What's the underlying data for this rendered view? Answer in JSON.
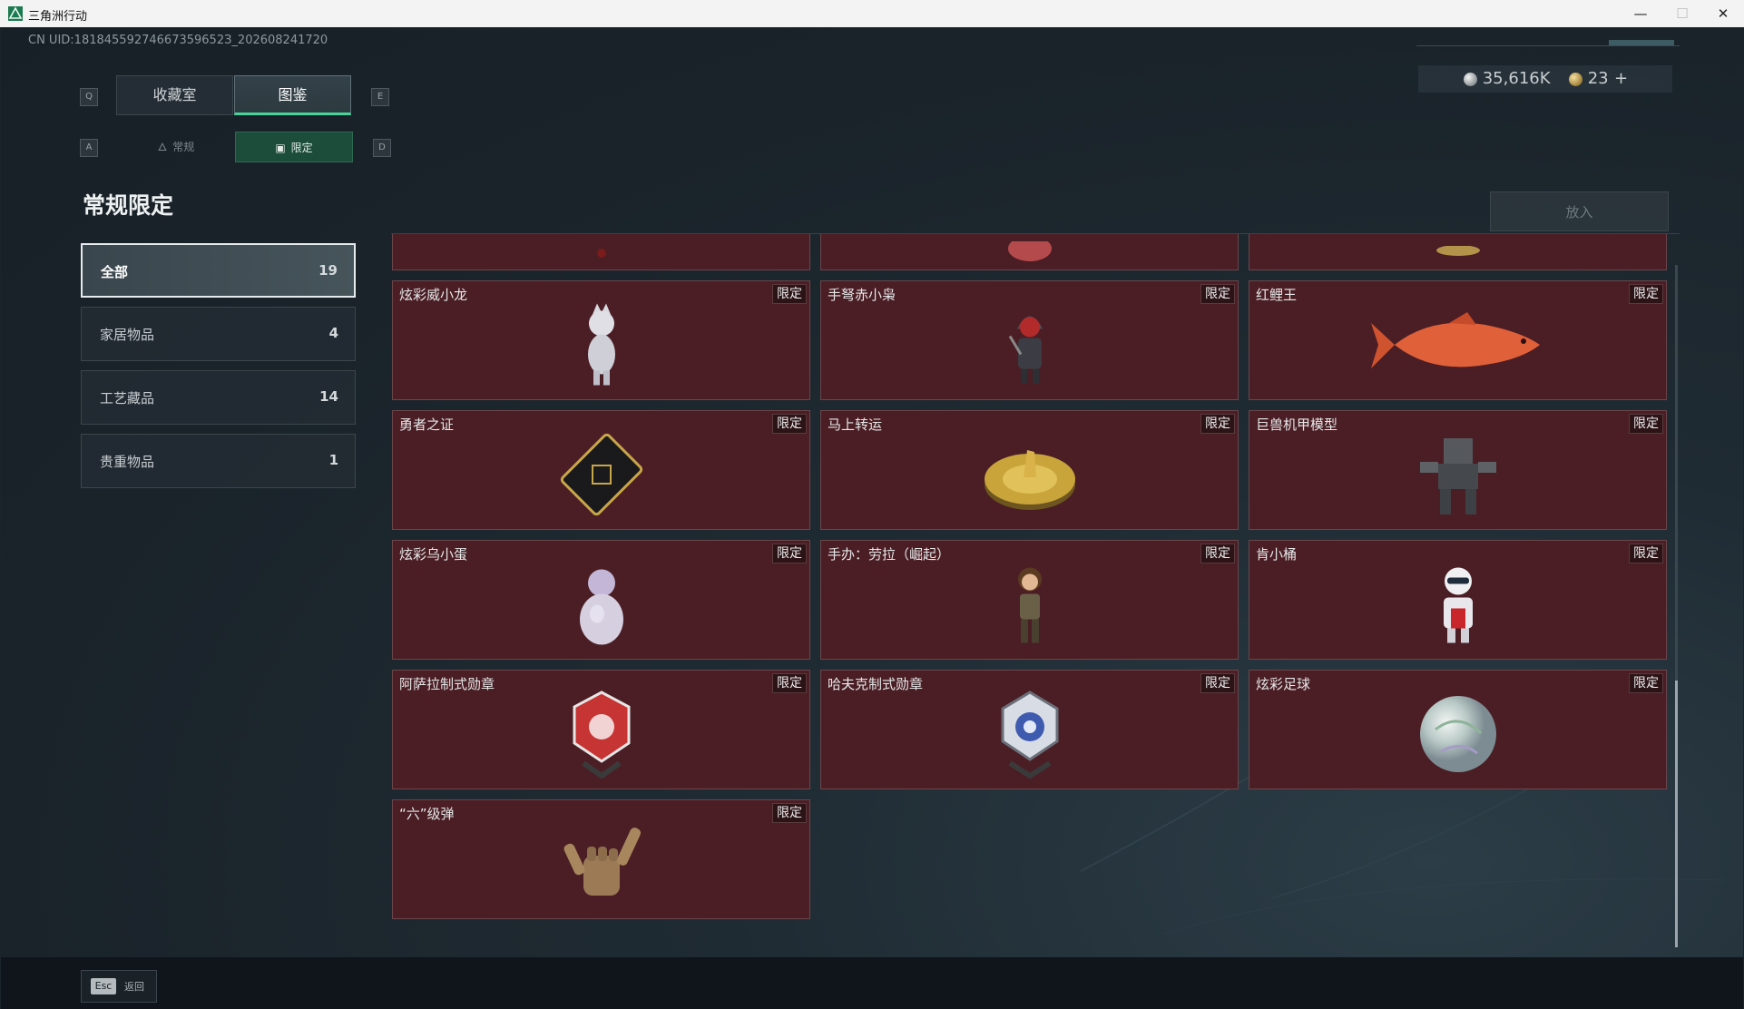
{
  "window": {
    "title": "三角洲行动",
    "minimize": "—",
    "maximize": "☐",
    "close": "✕"
  },
  "uid": "CN UID:18184559274667359652З_202608241720",
  "currency": {
    "silver": "35,616K",
    "gold": "23",
    "add": "+"
  },
  "tabs": {
    "prev_key": "Q",
    "next_key": "E",
    "items": [
      {
        "label": "收藏室"
      },
      {
        "label": "图鉴"
      }
    ]
  },
  "subtabs": {
    "prev_key": "A",
    "next_key": "D",
    "items": [
      {
        "label": "常规"
      },
      {
        "label": "限定"
      }
    ]
  },
  "section_title": "常规限定",
  "put_button": "放入",
  "categories": [
    {
      "label": "全部",
      "count": "19"
    },
    {
      "label": "家居物品",
      "count": "4"
    },
    {
      "label": "工艺藏品",
      "count": "14"
    },
    {
      "label": "贵重物品",
      "count": "1"
    }
  ],
  "cards": [
    {
      "name": "炫彩威小龙",
      "tag": "限定"
    },
    {
      "name": "手弩赤小枭",
      "tag": "限定"
    },
    {
      "name": "红鲤王",
      "tag": "限定"
    },
    {
      "name": "勇者之证",
      "tag": "限定"
    },
    {
      "name": "马上转运",
      "tag": "限定"
    },
    {
      "name": "巨兽机甲模型",
      "tag": "限定"
    },
    {
      "name": "炫彩乌小蛋",
      "tag": "限定"
    },
    {
      "name": "手办：劳拉（崛起）",
      "tag": "限定"
    },
    {
      "name": "肯小桶",
      "tag": "限定"
    },
    {
      "name": "阿萨拉制式勋章",
      "tag": "限定"
    },
    {
      "name": "哈夫克制式勋章",
      "tag": "限定"
    },
    {
      "name": "炫彩足球",
      "tag": "限定"
    },
    {
      "name": "“六”级弹",
      "tag": "限定"
    }
  ],
  "footer": {
    "esc_key": "Esc",
    "esc_label": "返回"
  },
  "colors": {
    "accent_green": "#47d49a",
    "card_bg": "#4a1e24",
    "tab_active_bg": "#1c4d3b"
  }
}
